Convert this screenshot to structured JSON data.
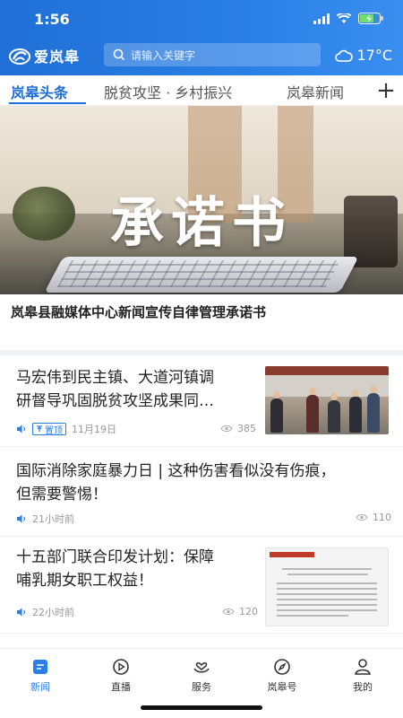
{
  "status": {
    "time": "1:56"
  },
  "app": {
    "logo_text": "爱岚皋",
    "search_placeholder": "请输入关键字",
    "temperature": "17°C"
  },
  "tabs": [
    {
      "label": "岚皋头条",
      "active": true
    },
    {
      "label": "脱贫攻坚 · 乡村振兴",
      "active": false
    },
    {
      "label": "岚皋新闻",
      "active": false
    }
  ],
  "banner": {
    "image_text": "承诺书",
    "headline": "岚皋县融媒体中心新闻宣传自律管理承诺书"
  },
  "news": [
    {
      "title_line1": "马宏伟到民主镇、大道河镇调",
      "title_line2": "研督导巩固脱贫攻坚成果同…",
      "pinned": true,
      "pin_label": "置顶",
      "time": "11月19日",
      "views": "385",
      "thumb": "photo"
    },
    {
      "title_line1": "国际消除家庭暴力日 | 这种伤害看似没有伤痕，",
      "title_line2": "但需要警惕！",
      "pinned": false,
      "time": "21小时前",
      "views": "110"
    },
    {
      "title_line1": "十五部门联合印发计划：保障",
      "title_line2": "哺乳期女职工权益！",
      "pinned": false,
      "time": "22小时前",
      "views": "120",
      "thumb": "document"
    }
  ],
  "nav": [
    {
      "label": "新闻",
      "icon": "news-icon",
      "active": true
    },
    {
      "label": "直播",
      "icon": "live-play-icon",
      "active": false
    },
    {
      "label": "服务",
      "icon": "service-hands-icon",
      "active": false
    },
    {
      "label": "岚皋号",
      "icon": "compass-icon",
      "active": false
    },
    {
      "label": "我的",
      "icon": "profile-icon",
      "active": false
    }
  ],
  "colors": {
    "brand": "#2a7fe6",
    "header_start": "#1f6fd6",
    "header_end": "#3a8ef0"
  }
}
